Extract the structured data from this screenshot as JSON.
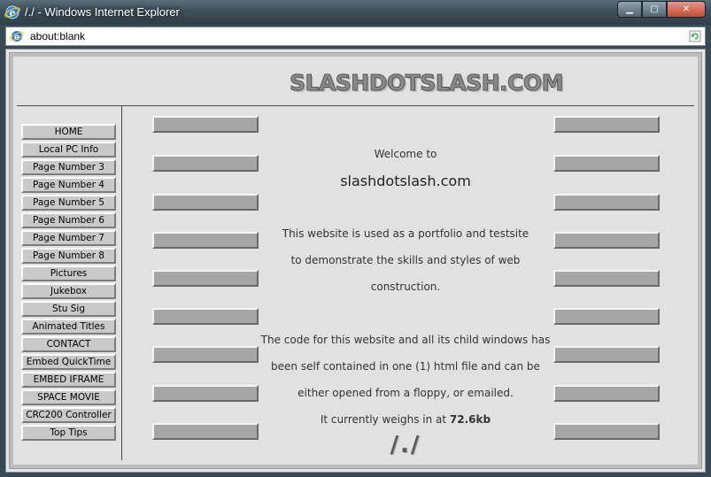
{
  "window": {
    "title": "/./ - Windows Internet Explorer",
    "icon": "ie-icon",
    "controls": [
      "minimize",
      "maximize",
      "close"
    ]
  },
  "addressbar": {
    "url": "about:blank"
  },
  "site": {
    "logo": "SLASHDOTSLASH.COM",
    "nav": [
      "HOME",
      "Local PC Info",
      "Page Number 3",
      "Page Number 4",
      "Page Number 5",
      "Page Number 6",
      "Page Number 7",
      "Page Number 8",
      "Pictures",
      "Jukebox",
      "Stu Sig",
      "Animated Titles",
      "CONTACT",
      "Embed QuickTime",
      "EMBED IFRAME",
      "SPACE MOVIE",
      "CRC200 Controller",
      "Top Tips"
    ],
    "welcome": "Welcome to",
    "site_name": "slashdotslash.com",
    "desc": [
      "This website is used as a portfolio and testsite",
      "to demonstrate the skills and styles of web",
      "construction."
    ],
    "code": [
      "The code for this website and all its child windows has",
      "been self contained in one (1) html file and can be",
      "either opened from a floppy, or emailed."
    ],
    "weighs_prefix": "It currently weighs in at ",
    "weight": "72.6kb",
    "signature": "/./"
  },
  "colors": {
    "page_bg": "#e1e1e1",
    "nav_button": "#c9c9c9",
    "deco_bar": "#a6a6a6",
    "text": "#333333"
  }
}
